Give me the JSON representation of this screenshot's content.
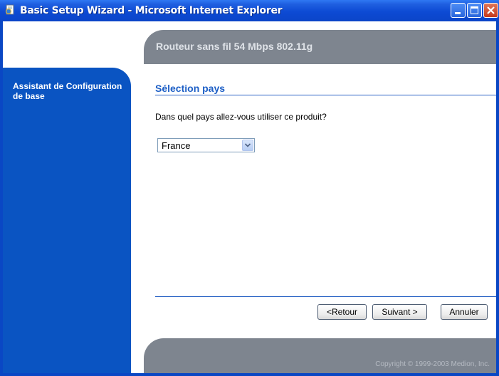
{
  "window": {
    "title": "Basic Setup Wizard - Microsoft Internet Explorer",
    "icon": "ie-page-icon",
    "controls": [
      "minimize-icon",
      "maximize-icon",
      "close-icon"
    ]
  },
  "header": {
    "title": "Routeur sans fil 54 Mbps 802.11g"
  },
  "sidebar": {
    "title": "Assistant de Configuration de base"
  },
  "main": {
    "section_title": "Sélection pays",
    "question": "Dans quel pays allez-vous utiliser ce produit?",
    "country_select": {
      "value": "France"
    }
  },
  "buttons": {
    "back_label": "<Retour",
    "next_label": "Suivant >",
    "cancel_label": "Annuler"
  },
  "footer": {
    "copyright": "Copyright © 1999-2003 Medion, Inc."
  },
  "colors": {
    "titlebar": "#0b45c8",
    "sidebar": "#0a54c2",
    "header_band": "#7e858f",
    "section_title": "#1d5fc6"
  }
}
